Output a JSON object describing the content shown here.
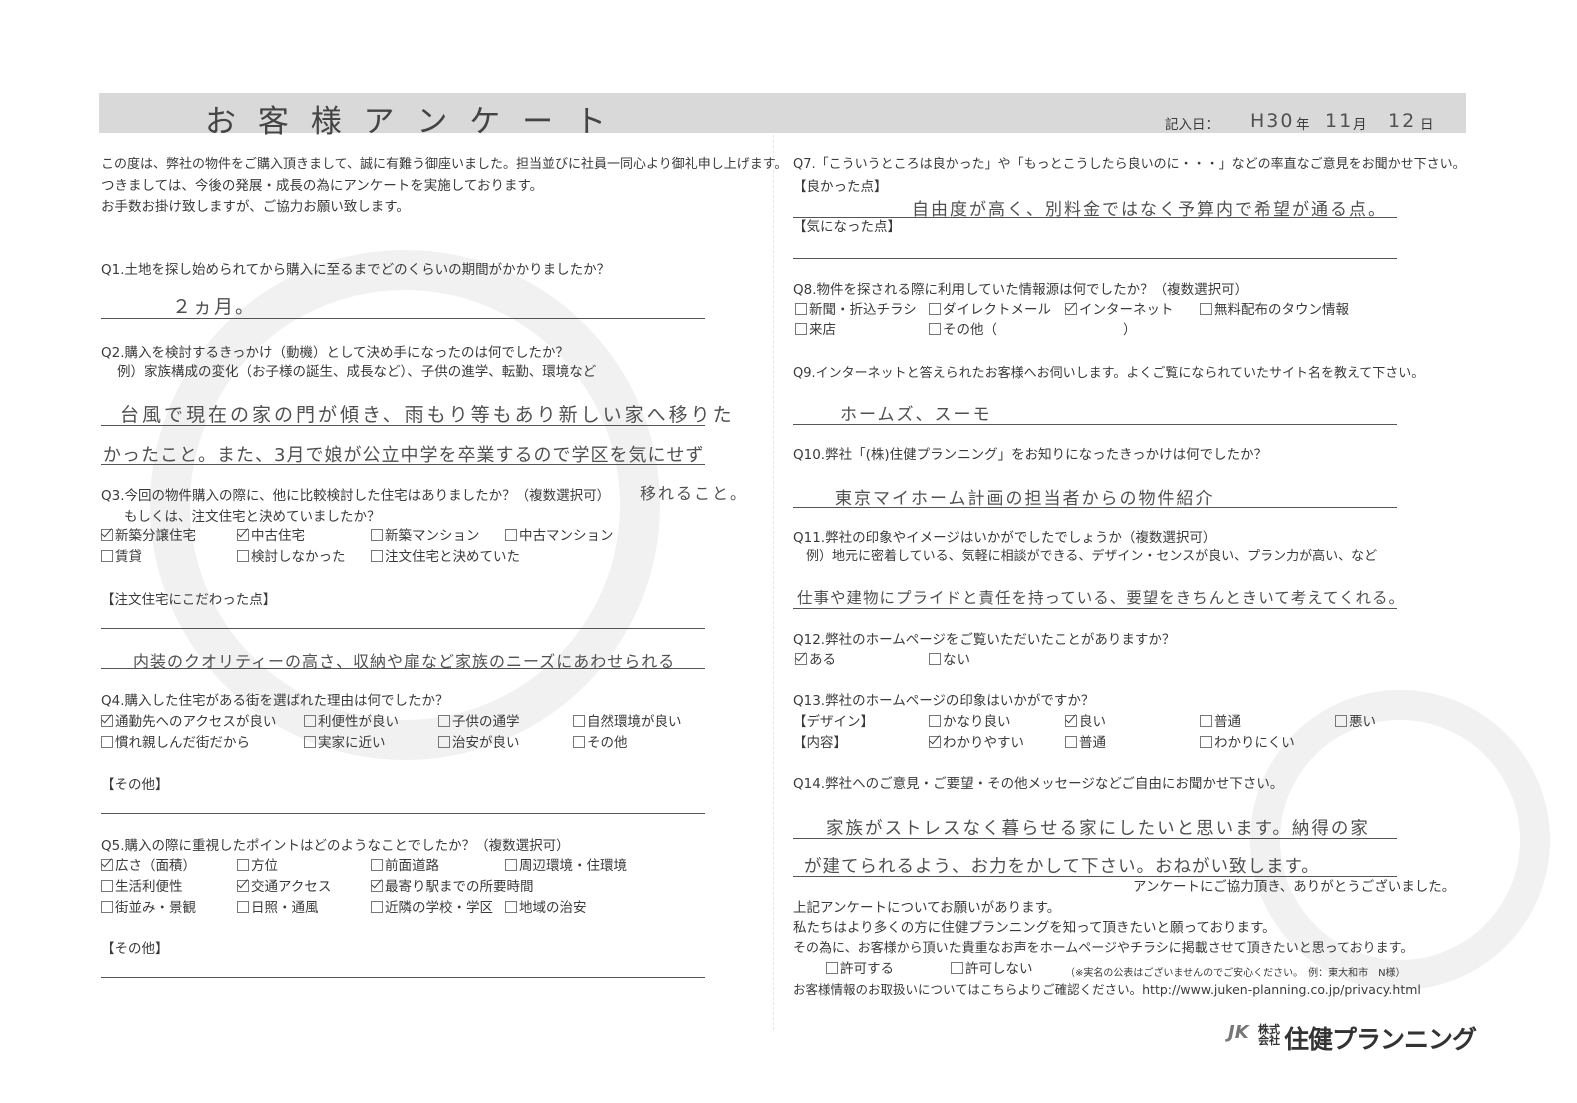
{
  "header": {
    "title": "お 客 様 ア ン ケ ー ト",
    "date_label": "記入日：",
    "date_year": "H30",
    "date_year_unit": "年",
    "date_month": "11",
    "date_month_unit": "月",
    "date_day": "12",
    "date_day_unit": "日"
  },
  "intro": [
    "この度は、弊社の物件をご購入頂きまして、誠に有難う御座いました。担当並びに社員一同心より御礼申し上げます。",
    "つきましては、今後の発展・成長の為にアンケートを実施しております。",
    "お手数お掛け致しますが、ご協力お願い致します。"
  ],
  "q1": {
    "question": "Q1.土地を探し始められてから購入に至るまでどのくらいの期間がかかりましたか？",
    "answer": "２ヵ月。"
  },
  "q2": {
    "question": "Q2.購入を検討するきっかけ（動機）として決め手になったのは何でしたか？",
    "example": "例）家族構成の変化（お子様の誕生、成長など）、子供の進学、転勤、環境など",
    "answer_line1": "台風で現在の家の門が傾き、雨もり等もあり新しい家へ移りた",
    "answer_line2": "かったこと。また、3月で娘が公立中学を卒業するので学区を気にせず",
    "answer_line3": "移れること。"
  },
  "q3": {
    "question": "Q3.今回の物件購入の際に、他に比較検討した住宅はありましたか？（複数選択可）",
    "question2": "もしくは、注文住宅と決めていましたか？",
    "options": [
      {
        "label": "新築分譲住宅",
        "checked": true
      },
      {
        "label": "中古住宅",
        "checked": true
      },
      {
        "label": "新築マンション",
        "checked": false
      },
      {
        "label": "中古マンション",
        "checked": false
      },
      {
        "label": "賃貸",
        "checked": false
      },
      {
        "label": "検討しなかった",
        "checked": false
      },
      {
        "label": "注文住宅と決めていた",
        "checked": false
      }
    ],
    "sub_label": "【注文住宅にこだわった点】",
    "sub_answer": "内装のクオリティーの高さ、収納や扉など家族のニーズにあわせられる"
  },
  "q4": {
    "question": "Q4.購入した住宅がある街を選ばれた理由は何でしたか？",
    "options": [
      {
        "label": "通勤先へのアクセスが良い",
        "checked": true
      },
      {
        "label": "利便性が良い",
        "checked": false
      },
      {
        "label": "子供の通学",
        "checked": false
      },
      {
        "label": "自然環境が良い",
        "checked": false
      },
      {
        "label": "慣れ親しんだ街だから",
        "checked": false
      },
      {
        "label": "実家に近い",
        "checked": false
      },
      {
        "label": "治安が良い",
        "checked": false
      },
      {
        "label": "その他",
        "checked": false
      }
    ],
    "other_label": "【その他】"
  },
  "q5": {
    "question": "Q5.購入の際に重視したポイントはどのようなことでしたか？（複数選択可）",
    "options": [
      {
        "label": "広さ（面積）",
        "checked": true
      },
      {
        "label": "方位",
        "checked": false
      },
      {
        "label": "前面道路",
        "checked": false
      },
      {
        "label": "周辺環境・住環境",
        "checked": false
      },
      {
        "label": "生活利便性",
        "checked": false
      },
      {
        "label": "交通アクセス",
        "checked": true
      },
      {
        "label": "最寄り駅までの所要時間",
        "checked": true
      },
      {
        "label": "街並み・景観",
        "checked": false
      },
      {
        "label": "日照・通風",
        "checked": false
      },
      {
        "label": "近隣の学校・学区",
        "checked": false
      },
      {
        "label": "地域の治安",
        "checked": false
      }
    ],
    "other_label": "【その他】"
  },
  "q7": {
    "question": "Q7.「こういうところは良かった」や「もっとこうしたら良いのに・・・」などの率直なご意見をお聞かせ下さい。",
    "good_label": "【良かった点】",
    "good_answer": "自由度が高く、別料金ではなく予算内で希望が通る点。",
    "concern_label": "【気になった点】"
  },
  "q8": {
    "question": "Q8.物件を探される際に利用していた情報源は何でしたか？（複数選択可）",
    "options": [
      {
        "label": "新聞・折込チラシ",
        "checked": false
      },
      {
        "label": "ダイレクトメール",
        "checked": false
      },
      {
        "label": "インターネット",
        "checked": true
      },
      {
        "label": "無料配布のタウン情報",
        "checked": false
      },
      {
        "label": "来店",
        "checked": false
      },
      {
        "label": "その他（",
        "checked": false
      }
    ],
    "paren_close": "）"
  },
  "q9": {
    "question": "Q9.インターネットと答えられたお客様へお伺いします。よくご覧になられていたサイト名を教えて下さい。",
    "answer": "ホームズ、スーモ"
  },
  "q10": {
    "question": "Q10.弊社「(株)住健プランニング」をお知りになったきっかけは何でしたか？",
    "answer": "東京マイホーム計画の担当者からの物件紹介"
  },
  "q11": {
    "question": "Q11.弊社の印象やイメージはいかがでしたでしょうか（複数選択可）",
    "example": "例）地元に密着している、気軽に相談ができる、デザイン・センスが良い、プラン力が高い、など",
    "answer": "仕事や建物にプライドと責任を持っている、要望をきちんときいて考えてくれる。"
  },
  "q12": {
    "question": "Q12.弊社のホームページをご覧いただいたことがありますか？",
    "options": [
      {
        "label": "ある",
        "checked": true
      },
      {
        "label": "ない",
        "checked": false
      }
    ]
  },
  "q13": {
    "question": "Q13.弊社のホームページの印象はいかがですか？",
    "design_label": "【デザイン】",
    "design_options": [
      {
        "label": "かなり良い",
        "checked": false
      },
      {
        "label": "良い",
        "checked": true
      },
      {
        "label": "普通",
        "checked": false
      },
      {
        "label": "悪い",
        "checked": false
      }
    ],
    "content_label": "【内容】",
    "content_options": [
      {
        "label": "わかりやすい",
        "checked": true
      },
      {
        "label": "普通",
        "checked": false
      },
      {
        "label": "わかりにくい",
        "checked": false
      }
    ]
  },
  "q14": {
    "question": "Q14.弊社へのご意見・ご要望・その他メッセージなどご自由にお聞かせ下さい。",
    "answer_line1": "家族がストレスなく暮らせる家にしたいと思います。納得の家",
    "answer_line2": "が建てられるよう、お力をかして下さい。おねがい致します。",
    "thanks": "アンケートにご協力頂き、ありがとうございました。"
  },
  "footer": {
    "line1": "上記アンケートについてお願いがあります。",
    "line2": "私たちはより多くの方に住健プランニングを知って頂きたいと願っております。",
    "line3": "その為に、お客様から頂いた貴重なお声をホームページやチラシに掲載させて頂きたいと思っております。",
    "permit": "許可する",
    "deny": "許可しない",
    "note": "（※実名の公表はございませんのでご安心ください。　例：東大和市　N様）",
    "privacy": "お客様情報のお取扱いについてはこちらよりご確認ください。http://www.juken-planning.co.jp/privacy.html",
    "logo_company_type": "株式会社",
    "logo_name": "住健プランニング",
    "logo_mark": "JK"
  }
}
